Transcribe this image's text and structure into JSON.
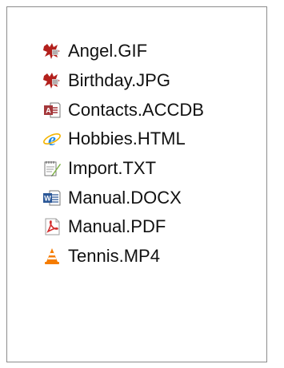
{
  "files": [
    {
      "name": "Angel.GIF",
      "icon": "image-icon"
    },
    {
      "name": "Birthday.JPG",
      "icon": "image-icon"
    },
    {
      "name": "Contacts.ACCDB",
      "icon": "access-database-icon"
    },
    {
      "name": "Hobbies.HTML",
      "icon": "internet-explorer-icon"
    },
    {
      "name": "Import.TXT",
      "icon": "text-document-icon"
    },
    {
      "name": "Manual.DOCX",
      "icon": "word-document-icon"
    },
    {
      "name": "Manual.PDF",
      "icon": "pdf-document-icon"
    },
    {
      "name": "Tennis.MP4",
      "icon": "vlc-media-icon"
    }
  ],
  "colors": {
    "pane_border": "#8c8c8c",
    "text": "#111111",
    "image_icon": "#b3201c",
    "access_icon": "#a4373a",
    "ie_icon": "#1e88e5",
    "word_icon": "#2b5797",
    "pdf_icon": "#d32f2f",
    "vlc_icon": "#f57c00"
  }
}
